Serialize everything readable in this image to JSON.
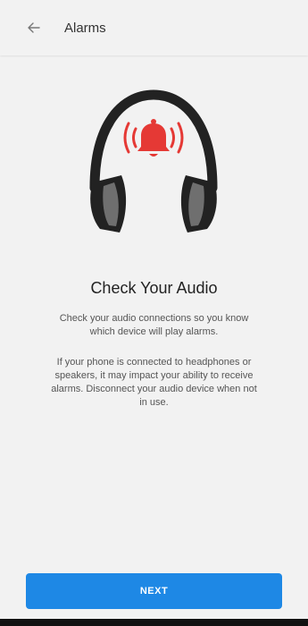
{
  "header": {
    "title": "Alarms",
    "back_icon": "arrow-left-icon"
  },
  "hero": {
    "icon": "headphones-alarm-bell-icon",
    "accent_color": "#e53935",
    "headphone_color": "#222222"
  },
  "content": {
    "title": "Check Your Audio",
    "paragraph1": "Check your audio connections so you know which device will play alarms.",
    "paragraph2": "If your phone is connected to headphones or speakers, it may impact your ability to receive alarms. Disconnect your audio device when not in use."
  },
  "footer": {
    "next_label": "NEXT",
    "button_color": "#1e88e5"
  }
}
